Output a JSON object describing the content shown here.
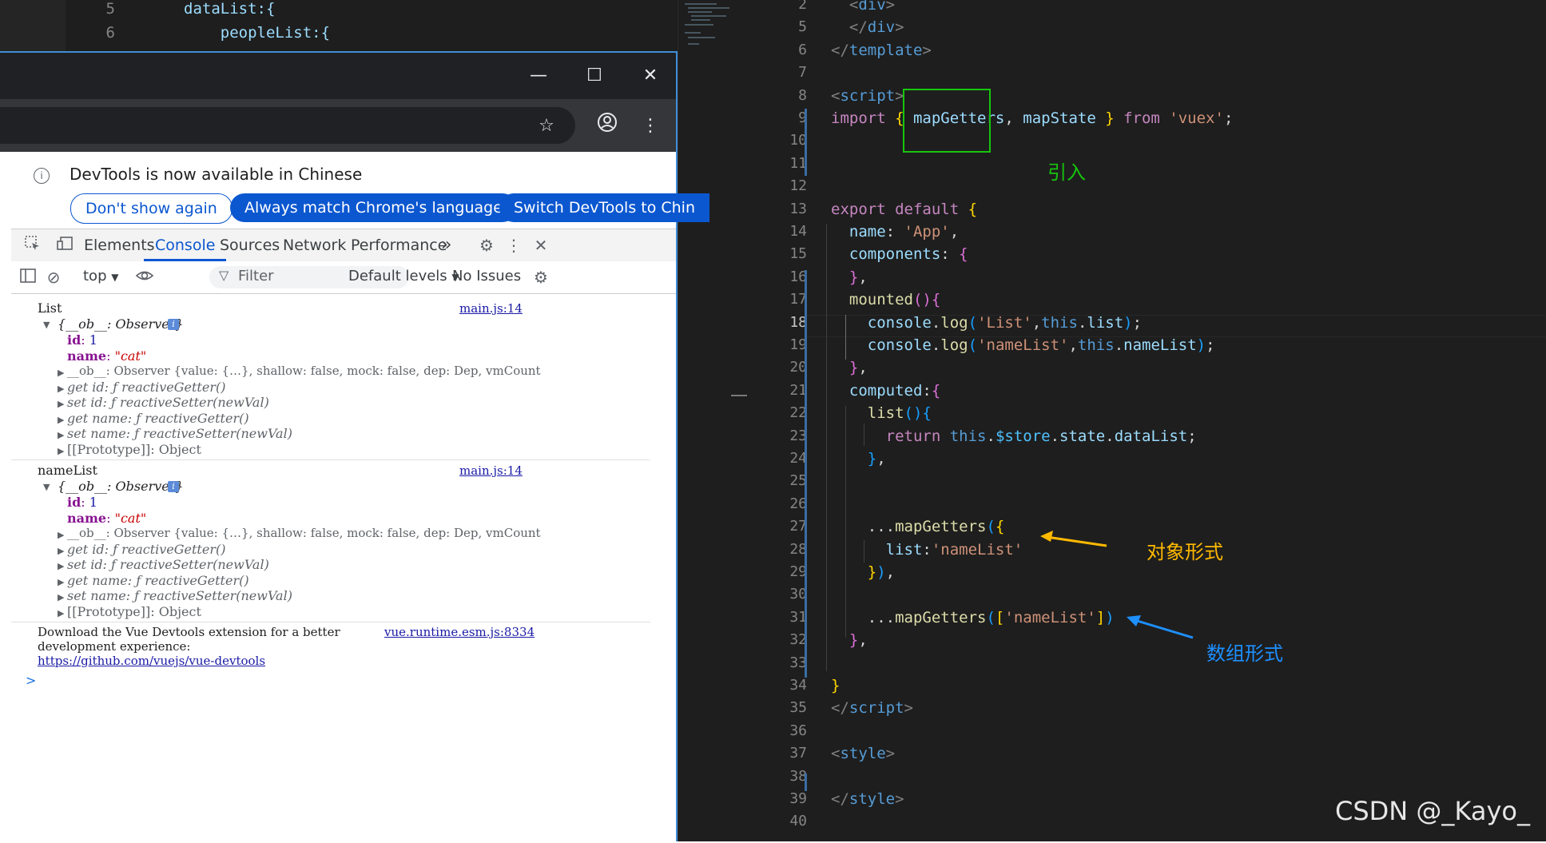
{
  "bg_editor": {
    "lines": [
      {
        "num": "5",
        "code": "dataList:{"
      },
      {
        "num": "6",
        "code": "    peopleList:{"
      }
    ]
  },
  "window_controls": {
    "minimize": "—",
    "maximize": "☐",
    "close": "✕"
  },
  "infobar": {
    "message": "DevTools is now available in Chinese",
    "btn_dont_show": "Don't show again",
    "btn_always_match": "Always match Chrome's language",
    "btn_switch": "Switch DevTools to Chin"
  },
  "devtools_tabs": [
    "Elements",
    "Console",
    "Sources",
    "Network",
    "Performance"
  ],
  "devtools_tabs_overflow": "»",
  "console_toolbar": {
    "context": "top",
    "filter_placeholder": "Filter",
    "levels": "Default levels",
    "issues": "No Issues"
  },
  "console": {
    "groups": [
      {
        "label": "List",
        "source": "main.js:14",
        "summary": "{__ob__: Observer}",
        "id_key": "id",
        "id_val": "1",
        "name_key": "name",
        "name_val": "\"cat\"",
        "ob_line": "__ob__: Observer  {value: {…}, shallow: false, mock: false, dep: Dep, vmCount",
        "get_id": "get id: ƒ reactiveGetter()",
        "set_id": "set id: ƒ reactiveSetter(newVal)",
        "get_name": "get name: ƒ reactiveGetter()",
        "set_name": "set name: ƒ reactiveSetter(newVal)",
        "proto": "[[Prototype]]: Object"
      },
      {
        "label": "nameList",
        "source": "main.js:14",
        "summary": "{__ob__: Observer}",
        "id_key": "id",
        "id_val": "1",
        "name_key": "name",
        "name_val": "\"cat\"",
        "ob_line": "__ob__: Observer  {value: {…}, shallow: false, mock: false, dep: Dep, vmCount",
        "get_id": "get id: ƒ reactiveGetter()",
        "set_id": "set id: ƒ reactiveSetter(newVal)",
        "get_name": "get name: ƒ reactiveGetter()",
        "set_name": "set name: ƒ reactiveSetter(newVal)",
        "proto": "[[Prototype]]: Object"
      }
    ],
    "vue_msg_1": "Download the Vue Devtools extension for a better",
    "vue_msg_2": "development experience:",
    "vue_link": "https://github.com/vuejs/vue-devtools",
    "vue_source": "vue.runtime.esm.js:8334",
    "prompt": ">"
  },
  "editor": {
    "lines": [
      {
        "num": "2",
        "segs": [
          [
            "t",
            "  <"
          ],
          [
            "b",
            "div"
          ],
          [
            "t",
            ">"
          ]
        ]
      },
      {
        "num": "5",
        "segs": [
          [
            "t",
            "  </"
          ],
          [
            "b",
            "div"
          ],
          [
            "t",
            ">"
          ]
        ]
      },
      {
        "num": "6",
        "segs": [
          [
            "t",
            "</"
          ],
          [
            "b",
            "template"
          ],
          [
            "t",
            ">"
          ]
        ]
      },
      {
        "num": "7",
        "segs": []
      },
      {
        "num": "8",
        "segs": [
          [
            "t",
            "<"
          ],
          [
            "b",
            "script"
          ],
          [
            "t",
            ">"
          ]
        ]
      },
      {
        "num": "9",
        "segs": [
          [
            "k",
            "import "
          ],
          [
            "y",
            "{ "
          ],
          [
            "v",
            "mapGetters"
          ],
          [
            "w",
            ", "
          ],
          [
            "v",
            "mapState "
          ],
          [
            "y",
            "} "
          ],
          [
            "k",
            "from "
          ],
          [
            "s",
            "'vuex'"
          ],
          [
            "w",
            ";"
          ]
        ]
      },
      {
        "num": "10",
        "segs": []
      },
      {
        "num": "11",
        "segs": []
      },
      {
        "num": "12",
        "segs": []
      },
      {
        "num": "13",
        "segs": [
          [
            "k",
            "export default "
          ],
          [
            "y",
            "{"
          ]
        ]
      },
      {
        "num": "14",
        "segs": [
          [
            "v",
            "  name"
          ],
          [
            "w",
            ": "
          ],
          [
            "s",
            "'App'"
          ],
          [
            "w",
            ","
          ]
        ]
      },
      {
        "num": "15",
        "segs": [
          [
            "v",
            "  components"
          ],
          [
            "w",
            ": "
          ],
          [
            "p",
            "{"
          ]
        ]
      },
      {
        "num": "16",
        "segs": [
          [
            "p",
            "  }"
          ],
          [
            "w",
            ","
          ]
        ]
      },
      {
        "num": "17",
        "segs": [
          [
            "f",
            "  mounted"
          ],
          [
            "p",
            "()"
          ],
          [
            "p",
            "{"
          ]
        ]
      },
      {
        "num": "18",
        "segs": [
          [
            "v",
            "    console"
          ],
          [
            "w",
            "."
          ],
          [
            "f",
            "log"
          ],
          [
            "bl",
            "("
          ],
          [
            "s",
            "'List'"
          ],
          [
            "w",
            ","
          ],
          [
            "b",
            "this"
          ],
          [
            "w",
            "."
          ],
          [
            "v",
            "list"
          ],
          [
            "bl",
            ")"
          ],
          [
            "w",
            ";"
          ]
        ]
      },
      {
        "num": "19",
        "segs": [
          [
            "v",
            "    console"
          ],
          [
            "w",
            "."
          ],
          [
            "f",
            "log"
          ],
          [
            "bl",
            "("
          ],
          [
            "s",
            "'nameList'"
          ],
          [
            "w",
            ","
          ],
          [
            "b",
            "this"
          ],
          [
            "w",
            "."
          ],
          [
            "v",
            "nameList"
          ],
          [
            "bl",
            ")"
          ],
          [
            "w",
            ";"
          ]
        ]
      },
      {
        "num": "20",
        "segs": [
          [
            "p",
            "  }"
          ],
          [
            "w",
            ","
          ]
        ]
      },
      {
        "num": "21",
        "segs": [
          [
            "v",
            "  computed"
          ],
          [
            "w",
            ":"
          ],
          [
            "p",
            "{"
          ]
        ]
      },
      {
        "num": "22",
        "segs": [
          [
            "f",
            "    list"
          ],
          [
            "bl",
            "()"
          ],
          [
            "bl",
            "{"
          ]
        ]
      },
      {
        "num": "23",
        "segs": [
          [
            "k",
            "      return "
          ],
          [
            "b",
            "this"
          ],
          [
            "w",
            "."
          ],
          [
            "c4",
            "$store"
          ],
          [
            "w",
            "."
          ],
          [
            "v",
            "state"
          ],
          [
            "w",
            "."
          ],
          [
            "v",
            "dataList"
          ],
          [
            "w",
            ";"
          ]
        ]
      },
      {
        "num": "24",
        "segs": [
          [
            "bl",
            "    }"
          ],
          [
            "w",
            ","
          ]
        ]
      },
      {
        "num": "25",
        "segs": []
      },
      {
        "num": "26",
        "segs": []
      },
      {
        "num": "27",
        "segs": [
          [
            "w",
            "    ..."
          ],
          [
            "f",
            "mapGetters"
          ],
          [
            "bl",
            "("
          ],
          [
            "y",
            "{"
          ]
        ]
      },
      {
        "num": "28",
        "segs": [
          [
            "v",
            "      list"
          ],
          [
            "w",
            ":"
          ],
          [
            "s",
            "'nameList'"
          ]
        ]
      },
      {
        "num": "29",
        "segs": [
          [
            "y",
            "    }"
          ],
          [
            "bl",
            ")"
          ],
          [
            "w",
            ","
          ]
        ]
      },
      {
        "num": "30",
        "segs": []
      },
      {
        "num": "31",
        "segs": [
          [
            "w",
            "    ..."
          ],
          [
            "f",
            "mapGetters"
          ],
          [
            "bl",
            "("
          ],
          [
            "y",
            "["
          ],
          [
            "s",
            "'nameList'"
          ],
          [
            "y",
            "]"
          ],
          [
            "bl",
            ")"
          ]
        ]
      },
      {
        "num": "32",
        "segs": [
          [
            "p",
            "  }"
          ],
          [
            "w",
            ","
          ]
        ]
      },
      {
        "num": "33",
        "segs": []
      },
      {
        "num": "34",
        "segs": [
          [
            "y",
            "}"
          ]
        ]
      },
      {
        "num": "35",
        "segs": [
          [
            "t",
            "</"
          ],
          [
            "b",
            "script"
          ],
          [
            "t",
            ">"
          ]
        ]
      },
      {
        "num": "36",
        "segs": []
      },
      {
        "num": "37",
        "segs": [
          [
            "t",
            "<"
          ],
          [
            "b",
            "style"
          ],
          [
            "t",
            ">"
          ]
        ]
      },
      {
        "num": "38",
        "segs": []
      },
      {
        "num": "39",
        "segs": [
          [
            "t",
            "</"
          ],
          [
            "b",
            "style"
          ],
          [
            "t",
            ">"
          ]
        ]
      },
      {
        "num": "40",
        "segs": []
      }
    ],
    "current_line": "18",
    "annotation_import": "引入",
    "annotation_object": "对象形式",
    "annotation_array": "数组形式"
  },
  "watermark": "CSDN @_Kayo_",
  "colors": {
    "accent": "#0b57d0",
    "annotation_green": "#16c60c",
    "annotation_orange": "#ffb900",
    "annotation_blue": "#1e90ff"
  }
}
